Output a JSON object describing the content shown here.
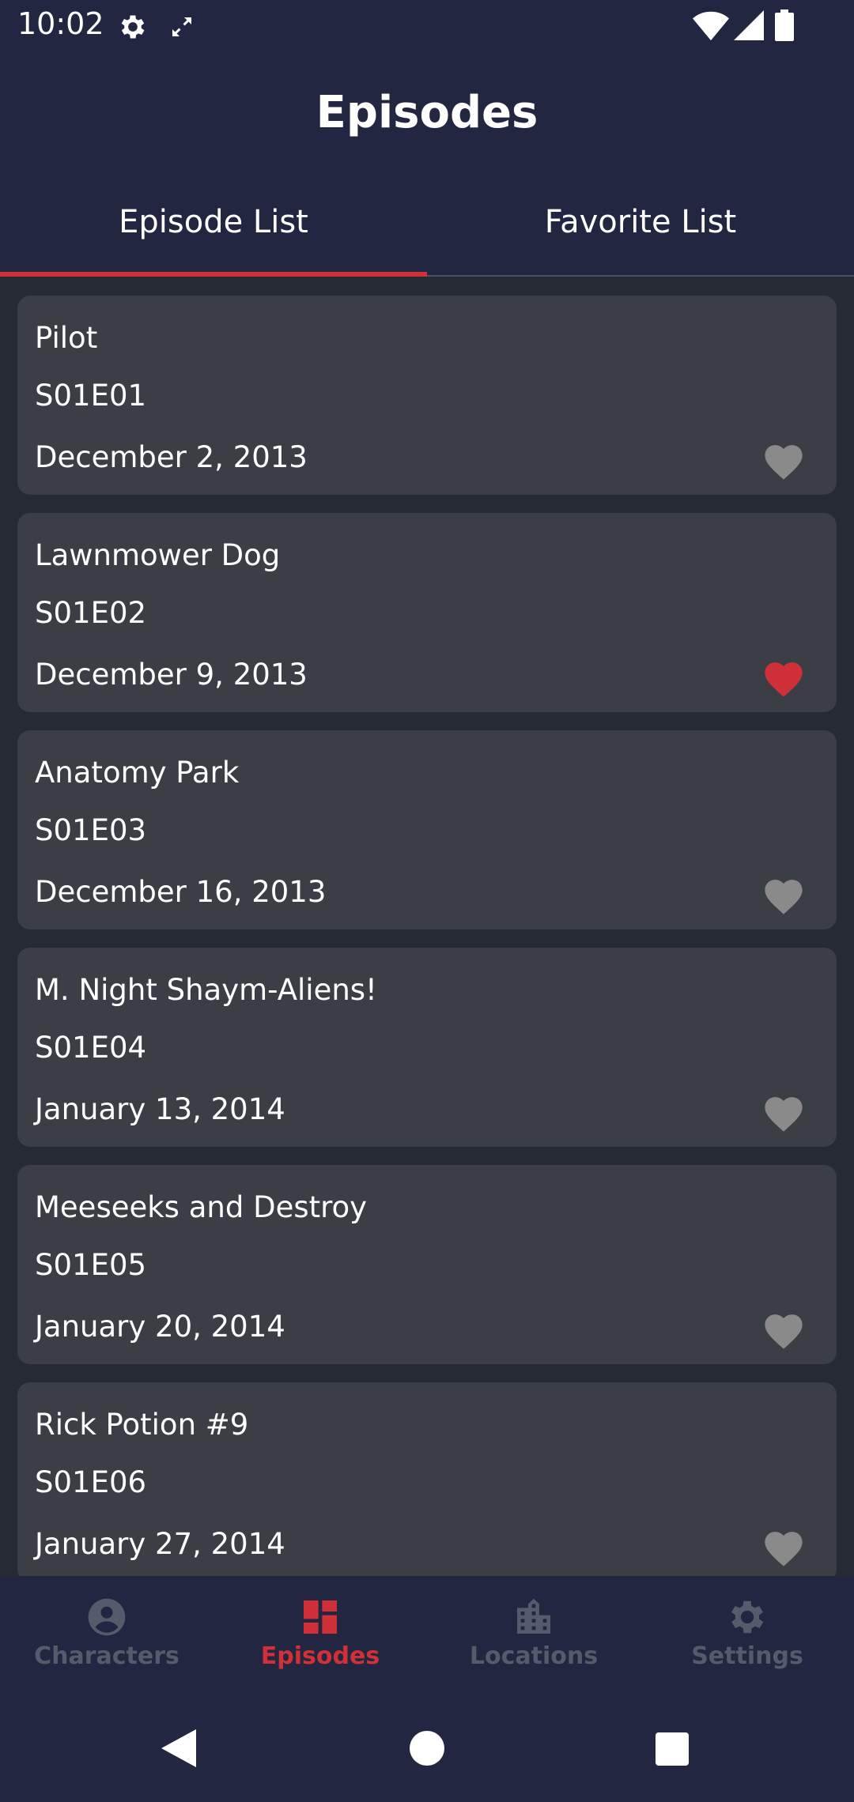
{
  "status": {
    "time": "10:02",
    "icons": [
      "gear-icon",
      "sync-icon",
      "wifi-icon",
      "signal-icon",
      "battery-icon"
    ]
  },
  "header": {
    "title": "Episodes"
  },
  "tabs": [
    {
      "label": "Episode List",
      "active": true
    },
    {
      "label": "Favorite List",
      "active": false
    }
  ],
  "episodes": [
    {
      "title": "Pilot",
      "code": "S01E01",
      "date": "December 2, 2013",
      "favorite": false
    },
    {
      "title": "Lawnmower Dog",
      "code": "S01E02",
      "date": "December 9, 2013",
      "favorite": true
    },
    {
      "title": "Anatomy Park",
      "code": "S01E03",
      "date": "December 16, 2013",
      "favorite": false
    },
    {
      "title": "M. Night Shaym-Aliens!",
      "code": "S01E04",
      "date": "January 13, 2014",
      "favorite": false
    },
    {
      "title": "Meeseeks and Destroy",
      "code": "S01E05",
      "date": "January 20, 2014",
      "favorite": false
    },
    {
      "title": "Rick Potion #9",
      "code": "S01E06",
      "date": "January 27, 2014",
      "favorite": false
    }
  ],
  "bottom_nav": [
    {
      "label": "Characters",
      "icon": "person-icon",
      "active": false
    },
    {
      "label": "Episodes",
      "icon": "dashboard-icon",
      "active": true
    },
    {
      "label": "Locations",
      "icon": "city-icon",
      "active": false
    },
    {
      "label": "Settings",
      "icon": "gear-icon",
      "active": false
    }
  ],
  "colors": {
    "appbar": "#232640",
    "background": "#262a33",
    "card": "#3b3e45",
    "accent": "#d03038",
    "heart_inactive": "#8a8a8a",
    "nav_inactive": "#565b6c"
  }
}
